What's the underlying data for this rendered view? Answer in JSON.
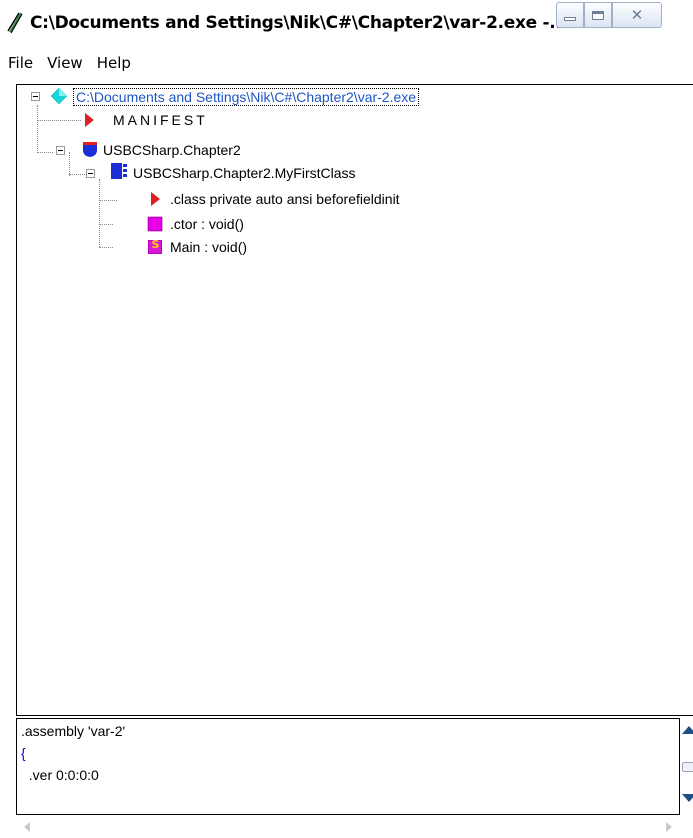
{
  "window": {
    "title": "C:\\Documents and Settings\\Nik\\C#\\Chapter2\\var-2.exe -...",
    "icon": "ildasm-lightning-icon",
    "controls": {
      "minimize": "minimize-icon",
      "maximize": "maximize-icon",
      "close": "✕"
    }
  },
  "menu": {
    "items": [
      "File",
      "View",
      "Help"
    ]
  },
  "tree": {
    "root": {
      "label": "C:\\Documents and Settings\\Nik\\C#\\Chapter2\\var-2.exe",
      "icon": "assembly-diamond-icon",
      "expanded": true,
      "selected": true
    },
    "manifest": {
      "label": "MANIFEST",
      "icon": "red-triangle-icon"
    },
    "namespace": {
      "label": "USBCSharp.Chapter2",
      "icon": "namespace-shield-icon",
      "expanded": true
    },
    "class": {
      "label": "USBCSharp.Chapter2.MyFirstClass",
      "icon": "class-icon",
      "expanded": true
    },
    "members": [
      {
        "label": ".class private auto ansi beforefieldinit",
        "icon": "red-triangle-icon"
      },
      {
        "label": ".ctor : void()",
        "icon": "method-icon"
      },
      {
        "label": "Main : void()",
        "icon": "static-method-icon",
        "badge": "S"
      }
    ]
  },
  "code": {
    "lines": [
      ".assembly 'var-2'",
      "{",
      "  .ver 0:0:0:0"
    ]
  },
  "colors": {
    "root_label": "#1d56c7",
    "triangle": "#e02020",
    "namespace": "#1a2fd6",
    "class": "#1a2fd6",
    "method": "#e600e6",
    "static_method_bg": "#c000c0",
    "static_method_badge": "#ffd200",
    "diamond": "#19d6d6"
  }
}
